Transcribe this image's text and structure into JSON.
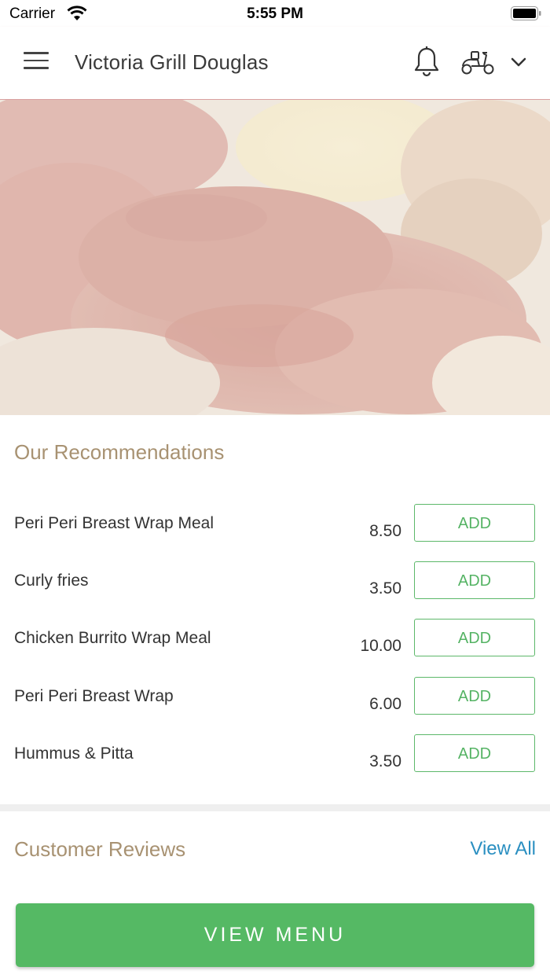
{
  "status_bar": {
    "carrier": "Carrier",
    "time": "5:55 PM"
  },
  "header": {
    "title": "Victoria Grill Douglas",
    "menu_icon": "hamburger-menu-icon",
    "bell_icon": "bell-icon",
    "delivery_icon": "scooter-icon",
    "dropdown_icon": "chevron-down-icon"
  },
  "recommendations": {
    "title": "Our Recommendations",
    "items": [
      {
        "name": "Peri Peri Breast Wrap Meal",
        "price": "8.50",
        "action": "ADD"
      },
      {
        "name": "Curly fries",
        "price": "3.50",
        "action": "ADD"
      },
      {
        "name": "Chicken Burrito Wrap Meal",
        "price": "10.00",
        "action": "ADD"
      },
      {
        "name": "Peri Peri Breast Wrap",
        "price": "6.00",
        "action": "ADD"
      },
      {
        "name": "Hummus & Pitta",
        "price": "3.50",
        "action": "ADD"
      }
    ]
  },
  "reviews": {
    "title": "Customer Reviews",
    "view_all": "View All"
  },
  "footer": {
    "view_menu": "VIEW MENU"
  },
  "colors": {
    "accent_green": "#55b964",
    "section_title": "#a89272",
    "link_blue": "#2a8fc1"
  }
}
